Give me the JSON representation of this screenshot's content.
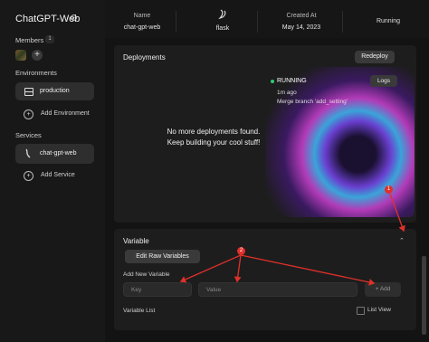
{
  "app": {
    "title": "ChatGPT-Web"
  },
  "sidebar": {
    "members_label": "Members",
    "members_count": "1",
    "environments_label": "Environments",
    "environment_name": "production",
    "add_environment": "Add Environment",
    "services_label": "Services",
    "service_name": "chat-gpt-web",
    "add_service": "Add Service"
  },
  "header": {
    "name_label": "Name",
    "name_value": "chat-gpt-web",
    "runtime_value": "flask",
    "created_label": "Created At",
    "created_value": "May 14, 2023",
    "status_value": "Running"
  },
  "deployments": {
    "title": "Deployments",
    "redeploy_label": "Redeploy",
    "empty_line1": "No more deployments found.",
    "empty_line2": "Keep building your cool stuff!",
    "card": {
      "status": "RUNNING",
      "time_ago": "1m ago",
      "commit_message": "Merge branch 'add_setting'",
      "logs_label": "Logs"
    }
  },
  "variable": {
    "title": "Variable",
    "raw_button": "Edit Raw Variables",
    "add_new_label": "Add New Variable",
    "key_placeholder": "Key",
    "value_placeholder": "Value",
    "add_button": "+ Add",
    "list_label": "Variable List",
    "list_view_label": "List View"
  },
  "annotations": {
    "marker1": "1",
    "marker2": "2"
  },
  "colors": {
    "status_running": "#2ecc71",
    "annotation_red": "#e0302a"
  }
}
